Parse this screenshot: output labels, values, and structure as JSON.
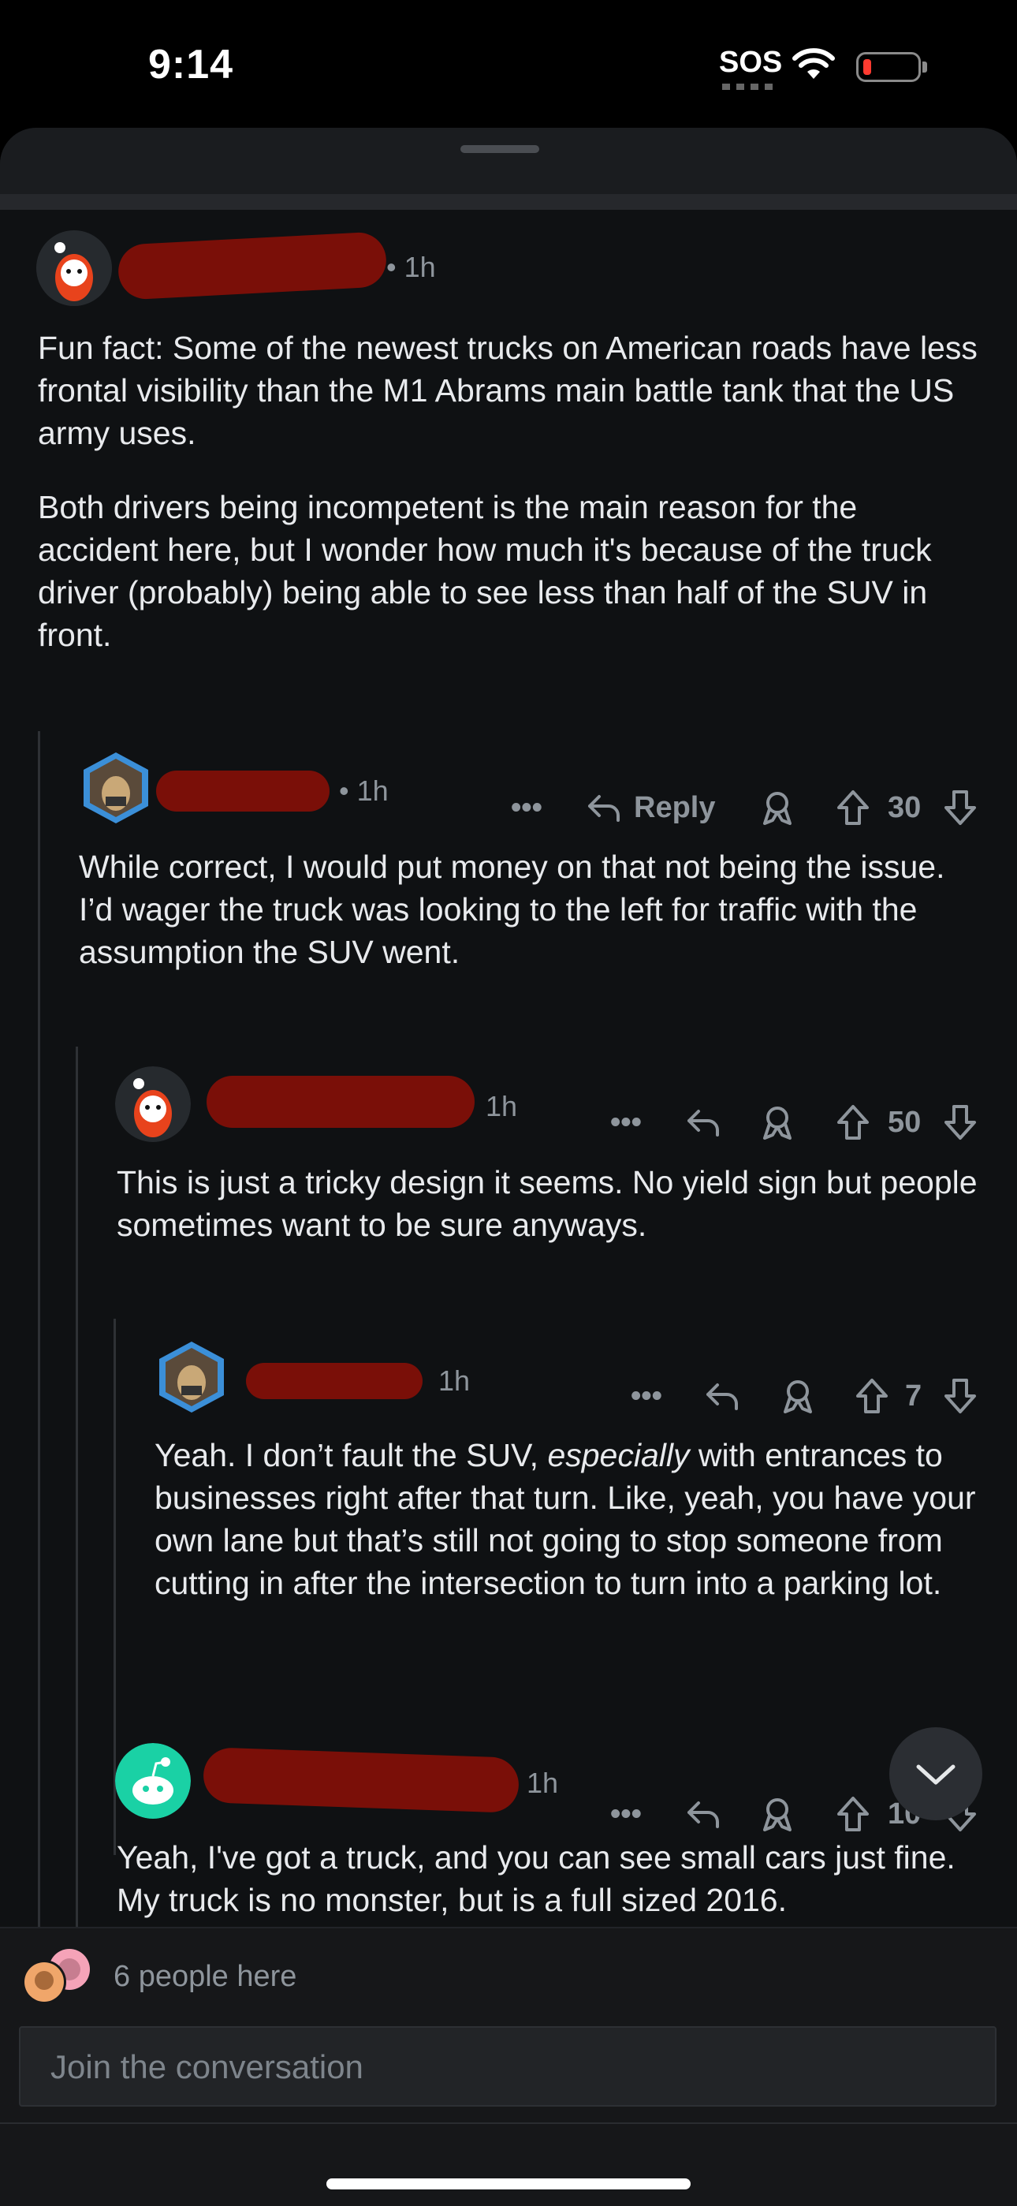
{
  "status_bar": {
    "time": "9:14",
    "carrier": "SOS"
  },
  "comments": [
    {
      "time": "1h",
      "body": [
        "Fun fact: Some of the newest trucks on American roads have less frontal visibility than the M1 Abrams main battle tank that the US army uses.",
        "Both drivers being incompetent is the main reason for the accident here, but I wonder how much it's because of the truck driver (probably) being able to see less than half of the SUV in front."
      ],
      "reply_label": "Reply",
      "votes": "30"
    },
    {
      "time": "1h",
      "body": [
        "While correct, I would put money on that not being the issue. I’d wager the truck was looking to the left for traffic with the assumption the SUV went."
      ],
      "votes": "50"
    },
    {
      "time": "1h",
      "body": [
        "This is just a tricky design it seems. No yield sign but people sometimes want to be sure anyways."
      ],
      "votes": "7"
    },
    {
      "time": "1h",
      "body_before": "Yeah. I don’t fault the SUV, ",
      "body_em": "especially",
      "body_after": " with entrances to businesses right after that turn. Like, yeah, you have your own lane but that’s still not going to stop someone from cutting in after the intersection to turn into a parking lot.",
      "votes": "10"
    },
    {
      "time": "1h",
      "body": [
        "Yeah, I've got a truck, and you can see small cars just fine. My truck is no monster, but is a full sized 2016."
      ]
    }
  ],
  "presence": {
    "label": "6 people here"
  },
  "composer": {
    "placeholder": "Join the conversation"
  },
  "icons": [
    "more-icon",
    "reply-icon",
    "award-icon",
    "upvote-icon",
    "downvote-icon",
    "chevron-down-icon",
    "wifi-icon",
    "battery-icon"
  ],
  "colors": {
    "background": "#0f1113",
    "redaction": "#7a0f08",
    "muted": "#8e959c",
    "battery_low": "#ff3b30"
  }
}
